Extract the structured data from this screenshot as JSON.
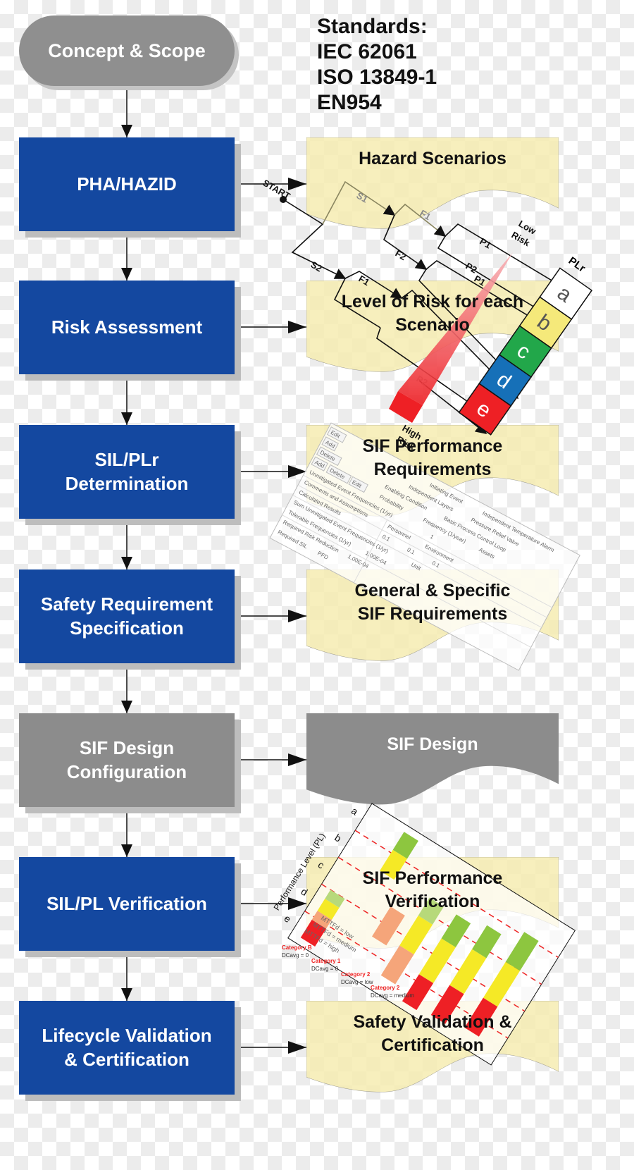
{
  "standards": {
    "title": "Standards:",
    "items": [
      "IEC 62061",
      "ISO 13849-1",
      "EN954"
    ]
  },
  "steps": [
    {
      "label": "Concept & Scope",
      "color": "#8f8f8f"
    },
    {
      "label": "PHA/HAZID",
      "color": "#1448a0"
    },
    {
      "label": "Risk Assessment",
      "color": "#1448a0"
    },
    {
      "label": "SIL/PLr\nDetermination",
      "color": "#1448a0"
    },
    {
      "label": "Safety Requirement\nSpecification",
      "color": "#1448a0"
    },
    {
      "label": "SIF Design\nConfiguration",
      "color": "#8c8c8c"
    },
    {
      "label": "SIL/PL Verification",
      "color": "#1448a0"
    },
    {
      "label": "Lifecycle Validation\n& Certification",
      "color": "#1448a0"
    }
  ],
  "outputs": [
    {
      "label": "Hazard Scenarios"
    },
    {
      "label": "Level of Risk for each\nScenario"
    },
    {
      "label": "SIF Performance\nRequirements"
    },
    {
      "label": "General & Specific\nSIF Requirements"
    },
    {
      "label": "SIF Design"
    },
    {
      "label": "SIF Performance\nVerification"
    },
    {
      "label": "Safety Validation &\nCertification"
    }
  ],
  "risk_graph": {
    "start": "START",
    "s1": "S1",
    "s2": "S2",
    "f1": "F1",
    "f2": "F2",
    "p1": "P1",
    "p2": "P2",
    "low_risk": [
      "Low",
      "Risk"
    ],
    "high_risk": [
      "High",
      "Risk"
    ],
    "plr": "PLr",
    "levels": [
      {
        "l": "a",
        "c": "#ffffff"
      },
      {
        "l": "b",
        "c": "#f5e97a"
      },
      {
        "l": "c",
        "c": "#22a74a"
      },
      {
        "l": "d",
        "c": "#1670b8"
      },
      {
        "l": "e",
        "c": "#ee2025"
      }
    ]
  },
  "table_snippet": {
    "buttons": [
      "Edit",
      "Add",
      "Delete",
      "Add",
      "Delete",
      "Edit"
    ],
    "labels": [
      "Initiating Event",
      "Independent Layers",
      "Enabling Condition",
      "Unmitigated Event Frequencies (1/yr)",
      "Comments and Assumptions",
      "Calculated Results",
      "Sum Unmitigated Event Frequencies (1/yr)",
      "Tolerable Frequencies (1/yr)",
      "Required Risk Reduction",
      "Required SIL",
      "Personnel",
      "Environment",
      "Assets",
      "Probability",
      "Frequency (1/year)",
      "Basic Process Control Loop",
      "Independent Temperature Alarm",
      "Pressure Relief Valve",
      "Unit",
      "PFD"
    ],
    "values": [
      "0.1",
      "0.1",
      "0.1",
      "1",
      "1.00E-04",
      "1.00E-04"
    ]
  },
  "pl_chart": {
    "ylabel": "Performance Level (PL)",
    "levels": [
      "a",
      "b",
      "c",
      "d",
      "e"
    ],
    "legend": [
      "MTTFd = low",
      "MTTFd = medium",
      "MTTFd = high"
    ],
    "categories": [
      {
        "name": "Category B",
        "dc": "DCavg = 0"
      },
      {
        "name": "Category 1",
        "dc": "DCavg = 0"
      },
      {
        "name": "Category 2",
        "dc": "DCavg = low"
      },
      {
        "name": "Category 2",
        "dc": "DCavg = medium"
      }
    ]
  }
}
